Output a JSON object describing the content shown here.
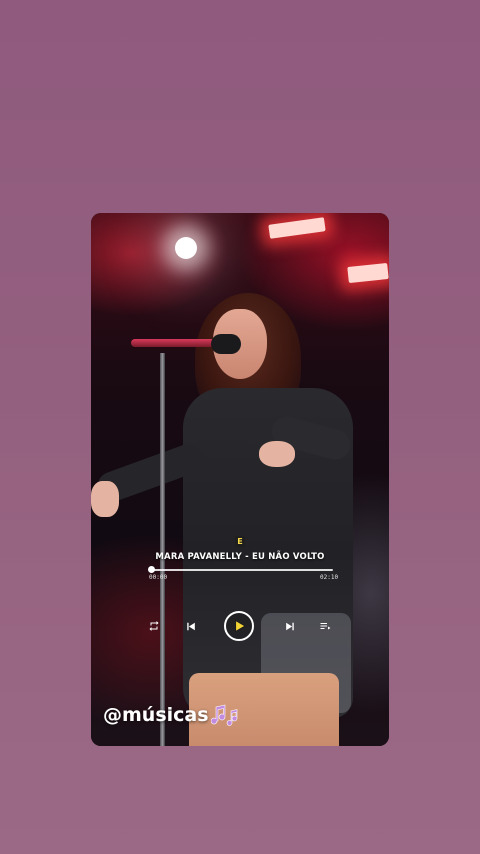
{
  "player": {
    "explicit_badge": "E",
    "track_title": "MARA PAVANELLY - EU NÃO VOLTO",
    "time_elapsed": "00:00",
    "time_total": "02:10",
    "progress_fraction": 0.0,
    "state": "paused"
  },
  "icons": {
    "repeat": "repeat-icon",
    "previous": "skip-previous-icon",
    "play": "play-icon",
    "next": "skip-next-icon",
    "queue": "queue-list-icon",
    "notes": "music-notes-icon"
  },
  "watermark": {
    "handle": "@músicas"
  },
  "colors": {
    "background": "#94607f",
    "play_icon_fill": "#f2d335",
    "notes_color": "#c38be0"
  }
}
